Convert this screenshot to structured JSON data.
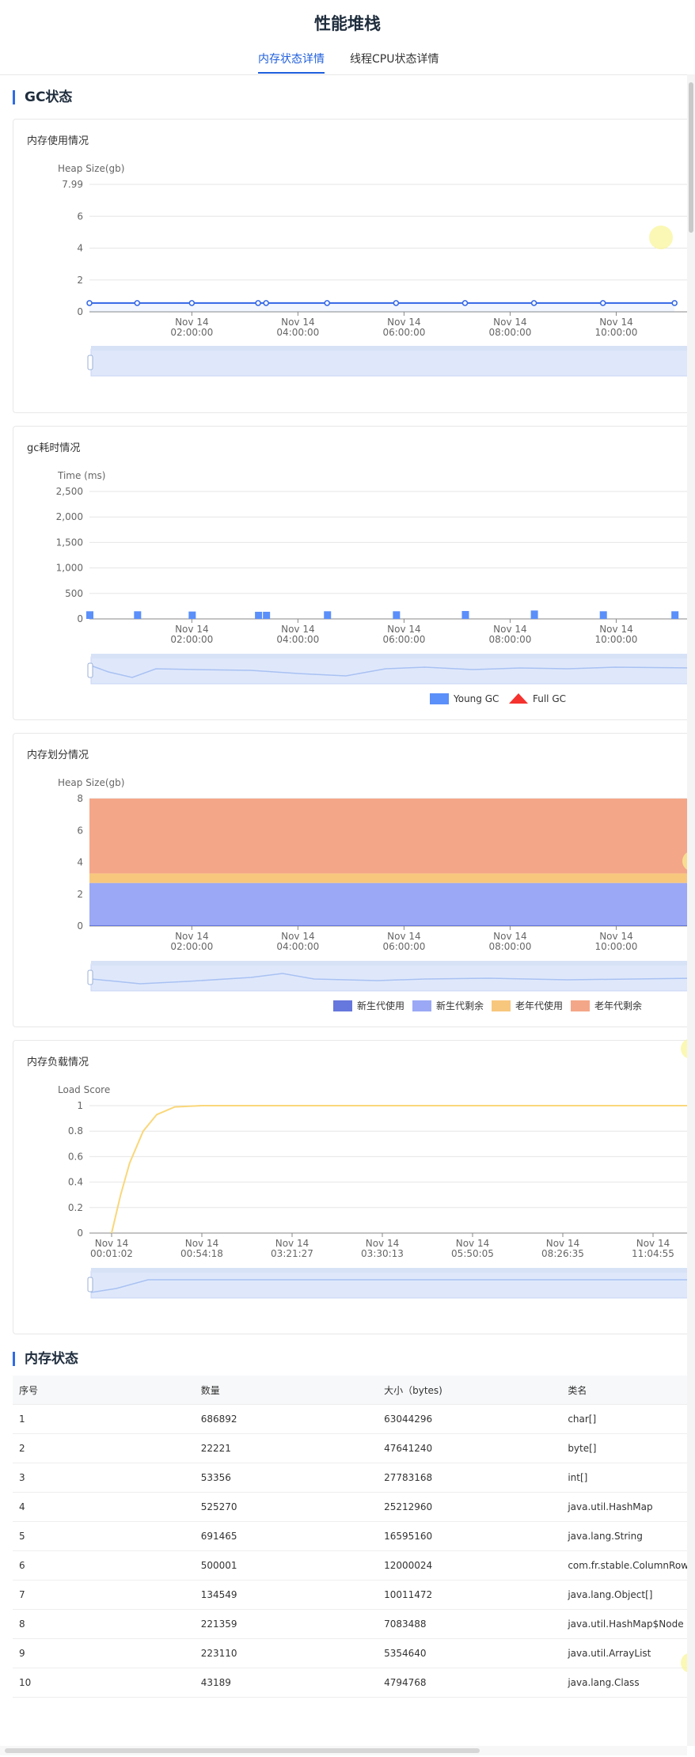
{
  "page": {
    "title": "性能堆栈"
  },
  "tabs": [
    {
      "label": "内存状态详情",
      "active": true
    },
    {
      "label": "线程CPU状态详情",
      "active": false
    }
  ],
  "sections": {
    "gc": "GC状态",
    "memory": "内存状态"
  },
  "colors": {
    "accent": "#1f5fdc",
    "young_gc": "#5b8ff9",
    "full_gc": "#f5322e",
    "new_used": "#6677dd",
    "new_free": "#9aa8f5",
    "old_used": "#f7c77e",
    "old_free": "#f4a688",
    "load": "#f9d77a"
  },
  "charts": {
    "heap": {
      "title": "内存使用情况"
    },
    "gc": {
      "title": "gc耗时情况"
    },
    "division": {
      "title": "内存划分情况"
    },
    "load": {
      "title": "内存负载情况"
    }
  },
  "chart_data": [
    {
      "type": "line",
      "title": "内存使用情况",
      "ylabel": "Heap Size(gb)",
      "ylim": [
        0,
        7.99
      ],
      "yticks": [
        "7.99",
        "6",
        "4",
        "2",
        "0"
      ],
      "xticks": [
        [
          "Nov 14",
          "02:00:00"
        ],
        [
          "Nov 14",
          "04:00:00"
        ],
        [
          "Nov 14",
          "06:00:00"
        ],
        [
          "Nov 14",
          "08:00:00"
        ],
        [
          "Nov 14",
          "10:00:00"
        ]
      ],
      "xrange_hours": [
        0.07,
        11.5
      ],
      "x": [
        0.07,
        0.97,
        2.0,
        3.25,
        3.4,
        4.55,
        5.85,
        7.15,
        8.45,
        9.75,
        11.1
      ],
      "values": [
        0.55,
        0.55,
        0.55,
        0.55,
        0.55,
        0.55,
        0.55,
        0.55,
        0.55,
        0.55,
        0.55
      ],
      "grid": true
    },
    {
      "type": "bar",
      "title": "gc耗时情况",
      "ylabel": "Time (ms)",
      "ylim": [
        0,
        2500
      ],
      "yticks": [
        "2,500",
        "2,000",
        "1,500",
        "1,000",
        "500",
        "0"
      ],
      "xticks": [
        [
          "Nov 14",
          "02:00:00"
        ],
        [
          "Nov 14",
          "04:00:00"
        ],
        [
          "Nov 14",
          "06:00:00"
        ],
        [
          "Nov 14",
          "08:00:00"
        ],
        [
          "Nov 14",
          "10:00:00"
        ]
      ],
      "xrange_hours": [
        0.07,
        11.5
      ],
      "series": [
        {
          "name": "Young GC",
          "x": [
            0.07,
            0.97,
            2.0,
            3.25,
            3.4,
            4.55,
            5.85,
            7.15,
            8.45,
            9.75,
            11.1
          ],
          "values": [
            150,
            150,
            145,
            140,
            140,
            150,
            150,
            155,
            165,
            150,
            150
          ]
        },
        {
          "name": "Full GC",
          "x": [],
          "values": []
        }
      ],
      "legend": "bottom-right",
      "grid": true
    },
    {
      "type": "area",
      "title": "内存划分情况",
      "ylabel": "Heap Size(gb)",
      "ylim": [
        0,
        8
      ],
      "yticks": [
        "8",
        "6",
        "4",
        "2",
        "0"
      ],
      "xticks": [
        [
          "Nov 14",
          "02:00:00"
        ],
        [
          "Nov 14",
          "04:00:00"
        ],
        [
          "Nov 14",
          "06:00:00"
        ],
        [
          "Nov 14",
          "08:00:00"
        ],
        [
          "Nov 14",
          "10:00:00"
        ]
      ],
      "series": [
        {
          "name": "新生代使用",
          "values": [
            0.05
          ]
        },
        {
          "name": "新生代剩余",
          "values": [
            2.65
          ]
        },
        {
          "name": "老年代使用",
          "values": [
            0.6
          ]
        },
        {
          "name": "老年代剩余",
          "values": [
            4.7
          ]
        }
      ],
      "legend": "bottom-right",
      "grid": true
    },
    {
      "type": "line",
      "title": "内存负载情况",
      "ylabel": "Load Score",
      "ylim": [
        0,
        1
      ],
      "yticks": [
        "1",
        "0.8",
        "0.6",
        "0.4",
        "0.2",
        "0"
      ],
      "xticks": [
        [
          "Nov 14",
          "00:01:02"
        ],
        [
          "Nov 14",
          "00:54:18"
        ],
        [
          "Nov 14",
          "03:21:27"
        ],
        [
          "Nov 14",
          "03:30:13"
        ],
        [
          "Nov 14",
          "05:50:05"
        ],
        [
          "Nov 14",
          "08:26:35"
        ],
        [
          "Nov 14",
          "11:04:55"
        ]
      ],
      "x_index": [
        0,
        0.1,
        0.2,
        0.35,
        0.5,
        0.7,
        1,
        6.6
      ],
      "values": [
        0,
        0.3,
        0.55,
        0.8,
        0.93,
        0.99,
        1,
        1
      ],
      "grid": true
    }
  ],
  "table": {
    "headers": [
      "序号",
      "数量",
      "大小（bytes)",
      "类名"
    ],
    "rows": [
      [
        "1",
        "686892",
        "63044296",
        "char[]"
      ],
      [
        "2",
        "22221",
        "47641240",
        "byte[]"
      ],
      [
        "3",
        "53356",
        "27783168",
        "int[]"
      ],
      [
        "4",
        "525270",
        "25212960",
        "java.util.HashMap"
      ],
      [
        "5",
        "691465",
        "16595160",
        "java.lang.String"
      ],
      [
        "6",
        "500001",
        "12000024",
        "com.fr.stable.ColumnRow"
      ],
      [
        "7",
        "134549",
        "10011472",
        "java.lang.Object[]"
      ],
      [
        "8",
        "221359",
        "7083488",
        "java.util.HashMap$Node"
      ],
      [
        "9",
        "223110",
        "5354640",
        "java.util.ArrayList"
      ],
      [
        "10",
        "43189",
        "4794768",
        "java.lang.Class"
      ]
    ]
  }
}
